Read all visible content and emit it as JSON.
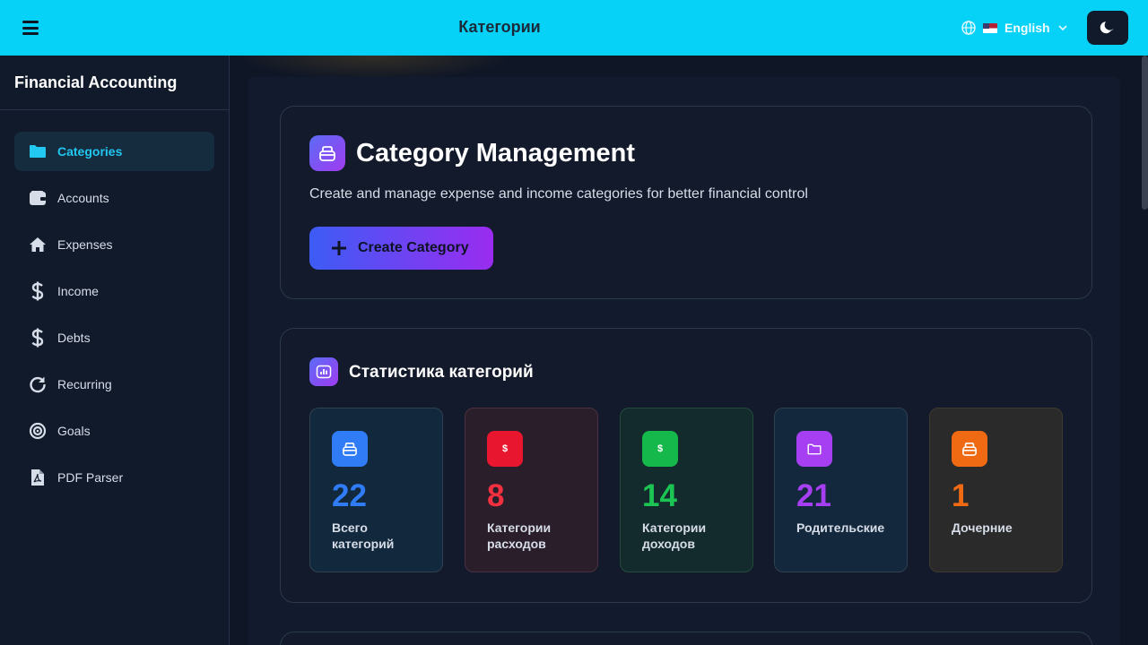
{
  "header": {
    "title": "Категории",
    "language": "English",
    "menu_icon": "hamburger-icon",
    "theme_icon": "moon-icon"
  },
  "sidebar": {
    "brand": "Financial Accounting",
    "items": [
      {
        "label": "Categories",
        "icon": "folder-icon",
        "active": true
      },
      {
        "label": "Accounts",
        "icon": "wallet-icon",
        "active": false
      },
      {
        "label": "Expenses",
        "icon": "home-icon",
        "active": false
      },
      {
        "label": "Income",
        "icon": "dollar-icon",
        "active": false
      },
      {
        "label": "Debts",
        "icon": "dollar-icon",
        "active": false
      },
      {
        "label": "Recurring",
        "icon": "refresh-icon",
        "active": false
      },
      {
        "label": "Goals",
        "icon": "target-icon",
        "active": false
      },
      {
        "label": "PDF Parser",
        "icon": "pdf-icon",
        "active": false
      }
    ]
  },
  "category_management": {
    "title": "Category Management",
    "subtitle": "Create and manage expense and income categories for better financial control",
    "create_button": "Create Category"
  },
  "stats": {
    "title": "Статистика категорий",
    "cards": [
      {
        "value": "22",
        "label": "Всего категорий",
        "color": "#2f7cf6",
        "icon": "box-icon"
      },
      {
        "value": "8",
        "label": "Категории расходов",
        "color": "#f2303f",
        "icon": "dollar-icon"
      },
      {
        "value": "14",
        "label": "Категории доходов",
        "color": "#1bc453",
        "icon": "dollar-icon"
      },
      {
        "value": "21",
        "label": "Родительские",
        "color": "#a63ff2",
        "icon": "folder-icon"
      },
      {
        "value": "1",
        "label": "Дочерние",
        "color": "#f06a14",
        "icon": "box-icon"
      }
    ]
  },
  "colors": {
    "header_bg": "#06d2f7",
    "active_nav": "#22c7f2",
    "accent_gradient_start": "#3d5cf5",
    "accent_gradient_end": "#9a2cf0"
  }
}
